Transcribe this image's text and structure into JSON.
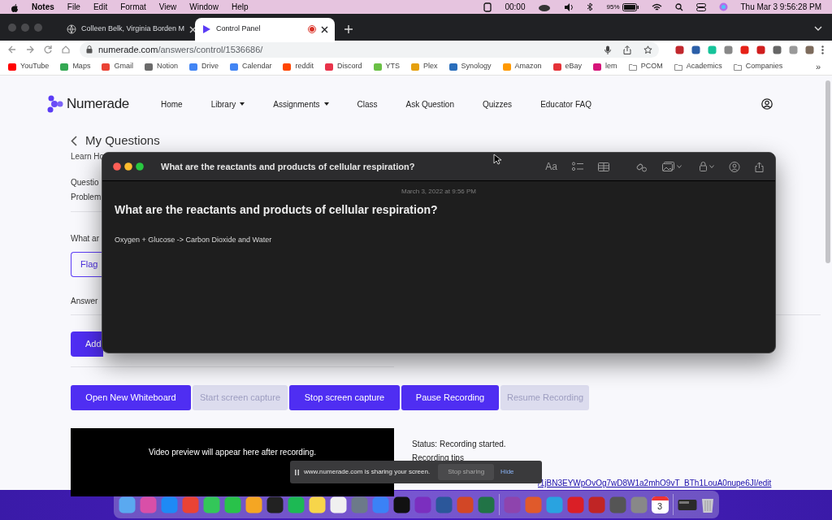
{
  "menubar": {
    "app": "Notes",
    "menus": [
      "File",
      "Edit",
      "Format",
      "View",
      "Window",
      "Help"
    ],
    "timer": "00:00",
    "battery": "95%",
    "clock": "Thu Mar 3  9:56:28 PM"
  },
  "browser": {
    "tabs": [
      {
        "title": "Colleen Belk, Virginia Borden M",
        "selected": false,
        "recording": false
      },
      {
        "title": "Control Panel",
        "selected": true,
        "recording": true
      }
    ],
    "url_host": "numerade.com",
    "url_path": "/answers/control/1536686/",
    "bookmarks": [
      {
        "label": "YouTube",
        "color": "#ff0000"
      },
      {
        "label": "Maps",
        "color": "#34a853"
      },
      {
        "label": "Gmail",
        "color": "#ea4335"
      },
      {
        "label": "Notion",
        "color": "#6b6b6b"
      },
      {
        "label": "Drive",
        "color": "#4285f4"
      },
      {
        "label": "Calendar",
        "color": "#4285f4"
      },
      {
        "label": "reddit",
        "color": "#ff4500"
      },
      {
        "label": "Discord",
        "color": "#e8334a"
      },
      {
        "label": "YTS",
        "color": "#6ac045"
      },
      {
        "label": "Plex",
        "color": "#e5a00d"
      },
      {
        "label": "Synology",
        "color": "#2a6ebb"
      },
      {
        "label": "Amazon",
        "color": "#ff9900"
      },
      {
        "label": "eBay",
        "color": "#e53238"
      },
      {
        "label": "lem",
        "color": "#d6157a"
      },
      {
        "label": "PCOM",
        "color": "#8a8a8a"
      },
      {
        "label": "Academics",
        "color": "#8a8a8a"
      },
      {
        "label": "Companies",
        "color": "#8a8a8a"
      }
    ],
    "more_bookmarks": "»"
  },
  "site": {
    "brand": "Numerade",
    "nav": [
      {
        "label": "Home",
        "dropdown": false
      },
      {
        "label": "Library",
        "dropdown": true
      },
      {
        "label": "Assignments",
        "dropdown": true
      },
      {
        "label": "Class",
        "dropdown": false
      },
      {
        "label": "Ask Question",
        "dropdown": false
      },
      {
        "label": "Quizzes",
        "dropdown": false
      },
      {
        "label": "Educator FAQ",
        "dropdown": false
      }
    ]
  },
  "page": {
    "heading": "My Questions",
    "learn": "Learn Ho",
    "question_label": "Questio",
    "problem_label": "Problem",
    "what": "What ar",
    "flag_button": "Flag",
    "answer_label": "Answer",
    "add_button": "Add",
    "controls": [
      {
        "label": "Open New Whiteboard",
        "disabled": false
      },
      {
        "label": "Start screen capture",
        "disabled": true
      },
      {
        "label": "Stop screen capture",
        "disabled": false
      },
      {
        "label": "Pause Recording",
        "disabled": false
      },
      {
        "label": "Resume Recording",
        "disabled": true
      }
    ],
    "video_preview": "Video preview will appear here after recording.",
    "status": "Status: Recording started.",
    "tips": "Recording tips",
    "link": "/1jBN3EYWpOvOg7wD8W1a2mhO9vT_BTh1LouA0nupe6JI/edit"
  },
  "notes_window": {
    "title": "What are the reactants and products of cellular respiration?",
    "date": "March 3, 2022 at 9:56 PM",
    "note_title": "What are the reactants and products of cellular respiration?",
    "note_body": "Oxygen + Glucose -> Carbon Dioxide and Water",
    "format_button": "Aa"
  },
  "sharing_bar": {
    "message": "www.numerade.com is sharing your screen.",
    "stop": "Stop sharing",
    "hide": "Hide"
  },
  "dock": {
    "calendar_day": "3"
  }
}
